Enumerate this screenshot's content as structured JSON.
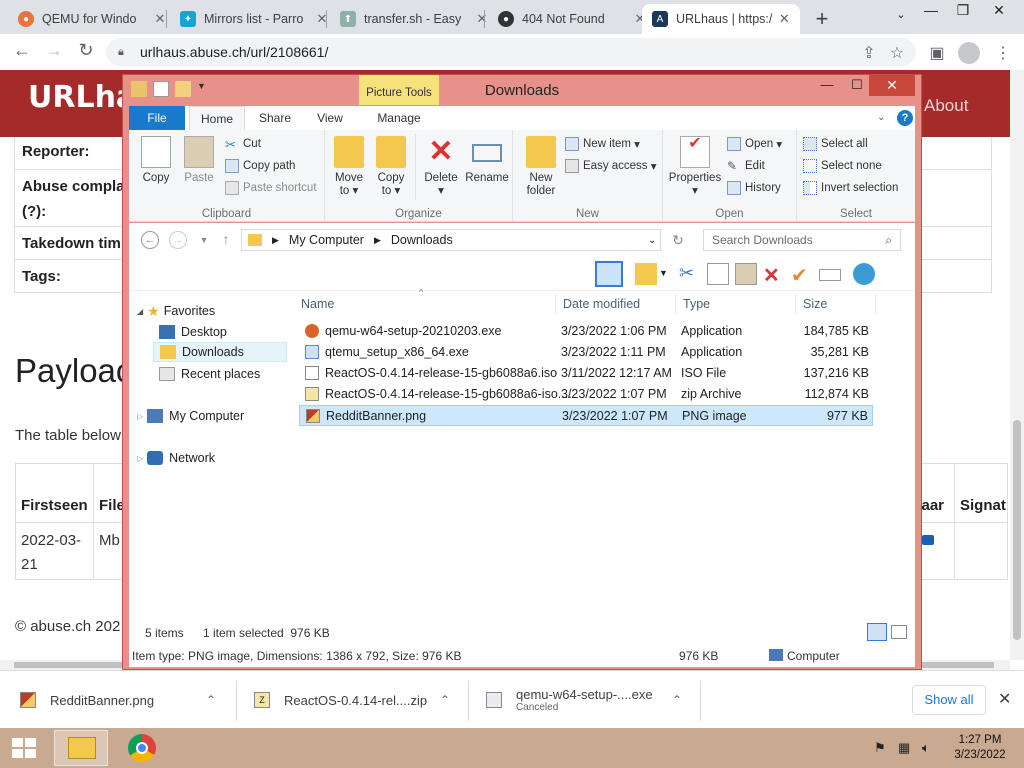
{
  "browser": {
    "tabs": [
      {
        "label": "QEMU for Windo",
        "icon": "qemu-icon",
        "active": false
      },
      {
        "label": "Mirrors list - Parro",
        "icon": "parrot-icon",
        "active": false
      },
      {
        "label": "transfer.sh - Easy",
        "icon": "transfer-icon",
        "active": false
      },
      {
        "label": "404 Not Found",
        "icon": "github-icon",
        "active": false
      },
      {
        "label": "URLhaus | https:/",
        "icon": "urlhaus-icon",
        "active": true
      }
    ],
    "new_tab": "+",
    "url": "urlhaus.abuse.ch/url/2108661/"
  },
  "page": {
    "logo": "URLhau",
    "about": "About",
    "info_rows": [
      {
        "key": "Reporter:"
      },
      {
        "key": "Abuse compla",
        "key2": "(?):"
      },
      {
        "key": "Takedown tim"
      },
      {
        "key": "Tags:"
      }
    ],
    "payload_heading": "Payloac",
    "payload_intro": "The table below",
    "table_headers": [
      "Firstseen",
      "File",
      "zaar",
      "Signat"
    ],
    "table_row": {
      "firstseen_line1": "2022-03-",
      "firstseen_line2": "21",
      "file": "Mb"
    },
    "footer": "© abuse.ch 202"
  },
  "explorer": {
    "title": "Downloads",
    "contextual_tab": "Picture Tools",
    "ribbon_tabs": [
      "File",
      "Home",
      "Share",
      "View",
      "Manage"
    ],
    "help": "?",
    "clipboard": {
      "copy": "Copy",
      "paste": "Paste",
      "cut": "Cut",
      "copy_path": "Copy path",
      "paste_shortcut": "Paste shortcut",
      "label": "Clipboard"
    },
    "organize": {
      "move_to": "Move",
      "move_to_2": "to",
      "copy_to": "Copy",
      "copy_to_2": "to",
      "delete": "Delete",
      "rename": "Rename",
      "label": "Organize"
    },
    "new": {
      "new_folder": "New",
      "new_folder_2": "folder",
      "new_item": "New item",
      "easy_access": "Easy access",
      "label": "New"
    },
    "open": {
      "properties": "Properties",
      "open": "Open",
      "edit": "Edit",
      "history": "History",
      "label": "Open"
    },
    "select": {
      "select_all": "Select all",
      "select_none": "Select none",
      "invert": "Invert selection",
      "label": "Select"
    },
    "breadcrumb": [
      "My Computer",
      "Downloads"
    ],
    "search_placeholder": "Search Downloads",
    "nav": {
      "favorites": "Favorites",
      "desktop": "Desktop",
      "downloads": "Downloads",
      "recent": "Recent places",
      "computer": "My Computer",
      "network": "Network"
    },
    "columns": {
      "name": "Name",
      "date": "Date modified",
      "type": "Type",
      "size": "Size"
    },
    "files": [
      {
        "name": "qemu-w64-setup-20210203.exe",
        "date": "3/23/2022 1:06 PM",
        "type": "Application",
        "size": "184,785 KB",
        "icon": "qemu-file-icon",
        "selected": false
      },
      {
        "name": "qtemu_setup_x86_64.exe",
        "date": "3/23/2022 1:11 PM",
        "type": "Application",
        "size": "35,281 KB",
        "icon": "installer-icon",
        "selected": false
      },
      {
        "name": "ReactOS-0.4.14-release-15-gb6088a6.iso",
        "date": "3/11/2022 12:17 AM",
        "type": "ISO File",
        "size": "137,216 KB",
        "icon": "iso-file-icon",
        "selected": false
      },
      {
        "name": "ReactOS-0.4.14-release-15-gb6088a6-iso....",
        "date": "3/23/2022 1:07 PM",
        "type": "zip Archive",
        "size": "112,874 KB",
        "icon": "zip-file-icon",
        "selected": false
      },
      {
        "name": "RedditBanner.png",
        "date": "3/23/2022 1:07 PM",
        "type": "PNG image",
        "size": "977 KB",
        "icon": "png-file-icon",
        "selected": true
      }
    ],
    "item_count": "5 items",
    "selection": "1 item selected  976 KB",
    "status_detail": "Item type: PNG image, Dimensions: 1386 x 792, Size: 976 KB",
    "status_size": "976 KB",
    "status_location": "Computer"
  },
  "downloads_bar": {
    "items": [
      {
        "name": "RedditBanner.png",
        "sub": ""
      },
      {
        "name": "ReactOS-0.4.14-rel....zip",
        "sub": ""
      },
      {
        "name": "qemu-w64-setup-....exe",
        "sub": "Canceled"
      }
    ],
    "show_all": "Show all"
  },
  "taskbar": {
    "time": "1:27 PM",
    "date": "3/23/2022"
  },
  "colors": {
    "banner": "#a52a2a",
    "window_frame": "#e8918a",
    "file_tab": "#1979ca",
    "selection": "#cce8ff"
  }
}
